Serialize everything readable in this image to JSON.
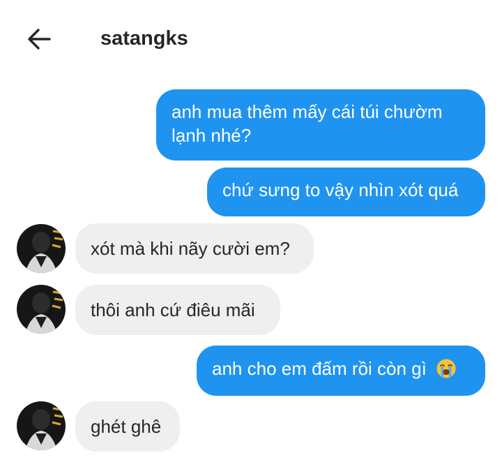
{
  "header": {
    "title": "satangks",
    "back_icon": "arrow-left-icon"
  },
  "colors": {
    "outgoing_bubble": "#1f93f0",
    "incoming_bubble": "#efefef",
    "text_dark": "#262626"
  },
  "messages": [
    {
      "direction": "out",
      "text": "anh mua thêm mấy cái túi chườm lạnh nhé?"
    },
    {
      "direction": "out",
      "text": "chứ sưng to vậy nhìn xót quá"
    },
    {
      "direction": "in",
      "text": "xót mà khi nãy cười em?",
      "avatar": "contact-avatar"
    },
    {
      "direction": "in",
      "text": "thôi anh cứ điêu mãi",
      "avatar": "contact-avatar"
    },
    {
      "direction": "out",
      "text": "anh cho em đấm rồi còn gì",
      "emoji": "loudly-crying-face-icon"
    },
    {
      "direction": "in",
      "text": "ghét ghê",
      "avatar": "contact-avatar"
    }
  ]
}
